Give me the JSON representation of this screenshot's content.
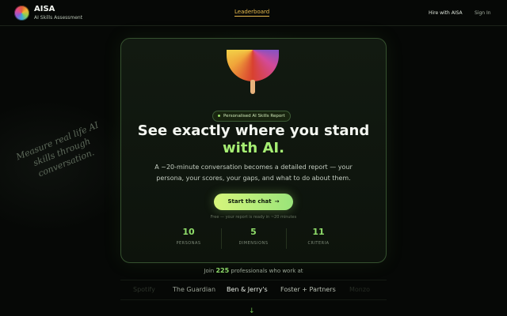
{
  "header": {
    "brand": "AISA",
    "brand_subtitle": "AI Skills Assessment",
    "nav_center": "Leaderboard",
    "nav_hire": "Hire with AISA",
    "nav_signin": "Sign In",
    "logo_icon": "rainbow-orb-logo"
  },
  "tagline": "Measure real life AI skills through conversation.",
  "hero": {
    "badge": "Personalised AI Skills Report",
    "headline_line1": "See exactly where you stand",
    "headline_line2": "with AI.",
    "subcopy": "A ~20-minute conversation becomes a detailed report — your persona, your scores, your gaps, and what to do about them.",
    "cta": "Start the chat",
    "cta_icon": "arrow-right-icon",
    "fine_print": "Free — your report is ready in ~20 minutes",
    "image_icon": "rainbow-fruit-illustration"
  },
  "stats": [
    {
      "value": "10",
      "label": "PERSONAS"
    },
    {
      "value": "5",
      "label": "DIMENSIONS"
    },
    {
      "value": "11",
      "label": "CRITERIA"
    }
  ],
  "social_proof": {
    "prefix": "Join",
    "count": "225",
    "suffix": "professionals who work at",
    "companies": [
      "Spotify",
      "The Guardian",
      "Ben & Jerry's",
      "Foster + Partners",
      "Monzo"
    ]
  },
  "colors": {
    "accent": "#a6ee73",
    "nav_active": "#e7b94d",
    "background": "#060806"
  },
  "scroll_icon": "arrow-down-icon"
}
